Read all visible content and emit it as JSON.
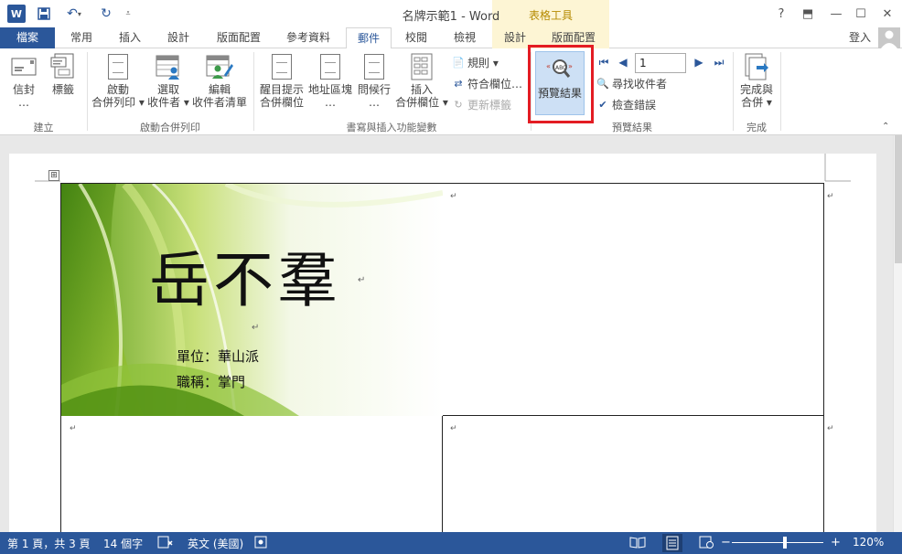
{
  "window": {
    "title": "名牌示範1 - Word",
    "contextual_group": "表格工具",
    "controls": {
      "help": "?",
      "ribbon_display": "⬒",
      "minimize": "—",
      "maximize": "☐",
      "close": "✕"
    }
  },
  "tabs": [
    {
      "label": "檔案"
    },
    {
      "label": "常用"
    },
    {
      "label": "插入"
    },
    {
      "label": "設計"
    },
    {
      "label": "版面配置"
    },
    {
      "label": "參考資料"
    },
    {
      "label": "郵件"
    },
    {
      "label": "校閱"
    },
    {
      "label": "檢視"
    },
    {
      "label": "設計"
    },
    {
      "label": "版面配置"
    }
  ],
  "active_tab": "郵件",
  "signin": "登入",
  "ribbon": {
    "create": {
      "label": "建立",
      "envelopes": "信封\n…",
      "labels": "標籤"
    },
    "start": {
      "label": "啟動合併列印",
      "start_merge": "啟動\n合併列印 ▾",
      "select_recipients": "選取\n收件者 ▾",
      "edit_list": "編輯\n收件者清單"
    },
    "write": {
      "label": "書寫與插入功能變數",
      "highlight": "醒目提示\n合併欄位",
      "address_block": "地址區塊\n…",
      "greeting_line": "問候行\n…",
      "insert_field": "插入\n合併欄位 ▾",
      "rules": "規則 ▾",
      "match_fields": "符合欄位…",
      "update_labels": "更新標籤"
    },
    "preview": {
      "label": "預覽結果",
      "preview_results": "預覽結果",
      "record_number": "1",
      "find_recipient": "尋找收件者",
      "check_errors": "檢查錯誤"
    },
    "finish": {
      "label": "完成",
      "finish_merge": "完成與\n合併 ▾"
    }
  },
  "document": {
    "card": {
      "name": "岳不羣",
      "unit_line": "單位：華山派",
      "title_line": "職稱：掌門"
    },
    "paragraph_mark": "↵",
    "move_handle": "⊞"
  },
  "status": {
    "page": "第 1 頁，共 3 頁",
    "words": "14 個字",
    "language": "英文 (美國)",
    "zoom_minus": "−",
    "zoom_plus": "+",
    "zoom": "120%"
  },
  "colors": {
    "word_blue": "#2b579a",
    "table_tools": "#b58a00",
    "highlight_red": "#e31c23"
  }
}
